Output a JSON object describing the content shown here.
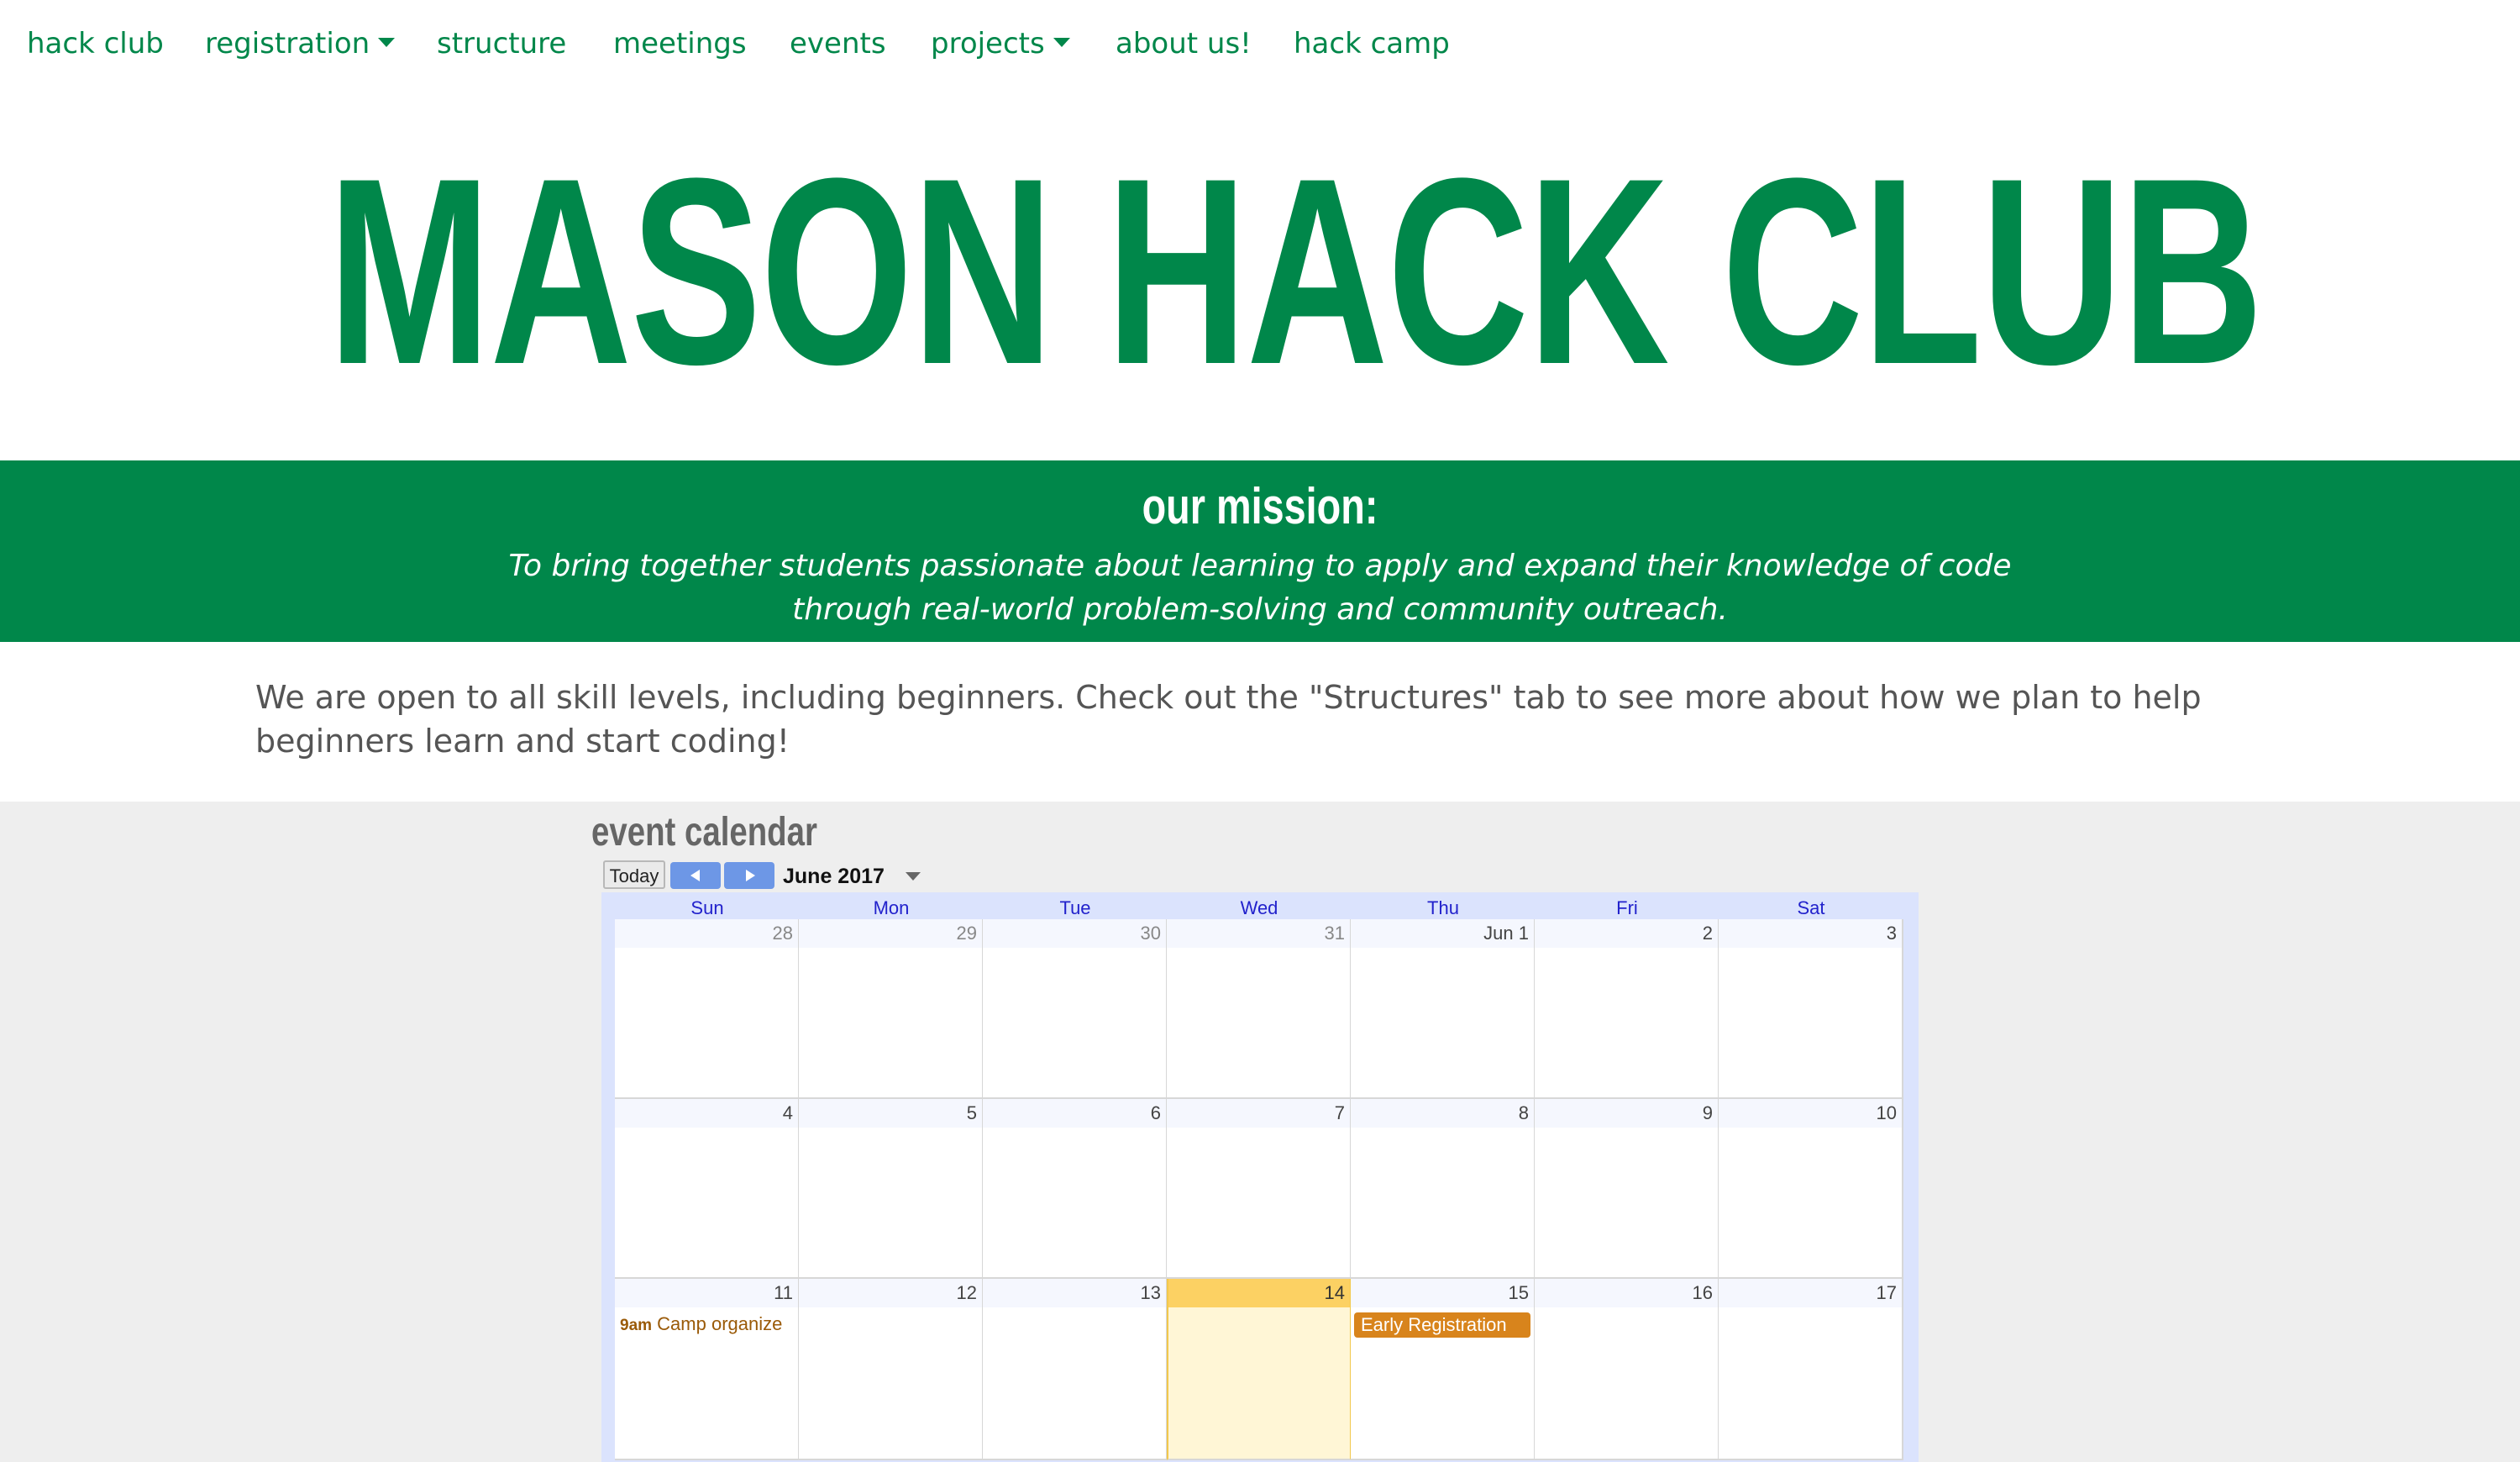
{
  "nav": {
    "items": [
      {
        "label": "hack club",
        "dropdown": false
      },
      {
        "label": "registration",
        "dropdown": true
      },
      {
        "label": "structure",
        "dropdown": false
      },
      {
        "label": "meetings",
        "dropdown": false
      },
      {
        "label": "events",
        "dropdown": false
      },
      {
        "label": "projects",
        "dropdown": true
      },
      {
        "label": "about us!",
        "dropdown": false
      },
      {
        "label": "hack camp",
        "dropdown": false
      }
    ]
  },
  "hero": {
    "title": "MASON HACK CLUB"
  },
  "mission": {
    "heading": "our mission:",
    "text": "To bring together students passionate about learning to apply and expand their knowledge of code through real-world problem-solving and community outreach."
  },
  "intro": {
    "text": "We are open to all skill levels, including beginners. Check out the \"Structures\" tab to see more about how we plan to help beginners learn and start coding!"
  },
  "calendar": {
    "heading": "event calendar",
    "today_label": "Today",
    "month_label": "June 2017",
    "weekdays": [
      "Sun",
      "Mon",
      "Tue",
      "Wed",
      "Thu",
      "Fri",
      "Sat"
    ],
    "weeks": [
      [
        "28",
        "29",
        "30",
        "31",
        "Jun 1",
        "2",
        "3"
      ],
      [
        "4",
        "5",
        "6",
        "7",
        "8",
        "9",
        "10"
      ],
      [
        "11",
        "12",
        "13",
        "14",
        "15",
        "16",
        "17"
      ]
    ],
    "other_month_days": [
      "28",
      "29",
      "30",
      "31"
    ],
    "today": "14",
    "events": [
      {
        "day": "11",
        "time": "9am",
        "title": "Camp organize",
        "style": "text"
      },
      {
        "day": "15",
        "time": "",
        "title": "Early Registration",
        "style": "chip"
      }
    ]
  },
  "colors": {
    "brand_green": "#00874a",
    "today_highlight": "#fcd163",
    "event_orange": "#d8841c",
    "nav_button_blue": "#6d97e6",
    "weekday_blue": "#2222cc"
  },
  "icons": {
    "dropdown": "caret-down-icon",
    "prev": "chevron-left-icon",
    "next": "chevron-right-icon"
  }
}
